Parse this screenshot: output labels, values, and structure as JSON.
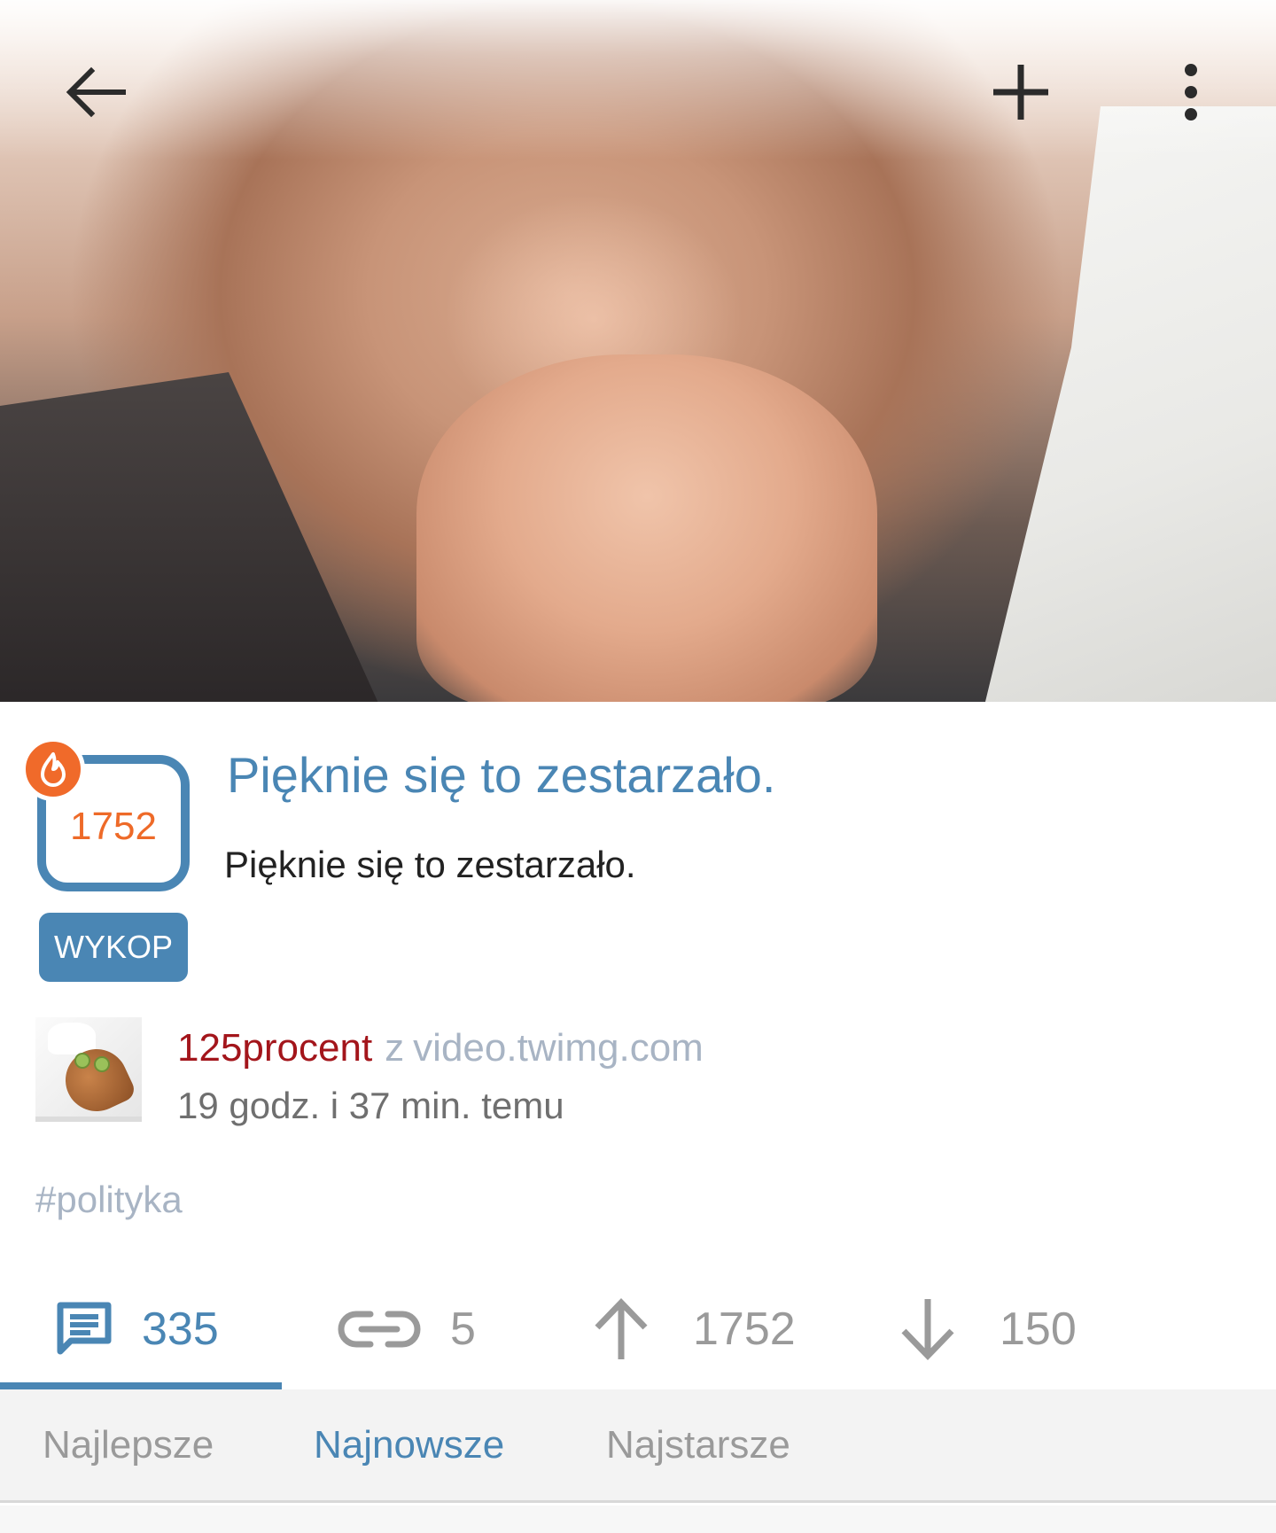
{
  "colors": {
    "accent": "#4a86b4",
    "hot": "#f06a2a",
    "vote_count": "#ee6a28",
    "author": "#a3151b",
    "muted": "#a8b4c4",
    "inactive": "#9a9a9a"
  },
  "toolbar": {
    "back_icon": "arrow-left-icon",
    "add_icon": "plus-icon",
    "more_icon": "more-vertical-icon"
  },
  "post": {
    "votes": "1752",
    "hot_icon": "flame-icon",
    "wykop_label": "WYKOP",
    "title": "Pięknie się to zestarzało.",
    "description": "Pięknie się to zestarzało.",
    "author": "125procent",
    "from_word": "z",
    "domain": "video.twimg.com",
    "time": "19 godz. i 37 min. temu",
    "tag": "#polityka"
  },
  "actions": {
    "comments": {
      "icon": "comment-icon",
      "count": "335"
    },
    "links": {
      "icon": "link-icon",
      "count": "5"
    },
    "upvotes": {
      "icon": "arrow-up-icon",
      "count": "1752"
    },
    "downvotes": {
      "icon": "arrow-down-icon",
      "count": "150"
    }
  },
  "sort": {
    "items": [
      "Najlepsze",
      "Najnowsze",
      "Najstarsze"
    ],
    "selected": "Najnowsze"
  }
}
